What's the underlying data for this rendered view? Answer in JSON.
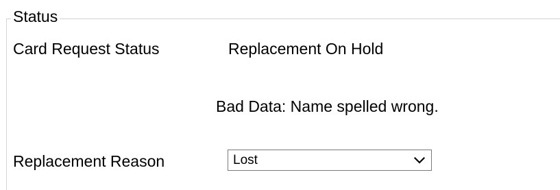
{
  "status_group": {
    "legend": "Status",
    "card_request_status_label": "Card Request Status",
    "card_request_status_value": "Replacement On Hold",
    "status_detail": "Bad Data: Name spelled wrong.",
    "replacement_reason_label": "Replacement Reason",
    "replacement_reason_value": "Lost",
    "dropdown_icon": "chevron-down-icon"
  }
}
